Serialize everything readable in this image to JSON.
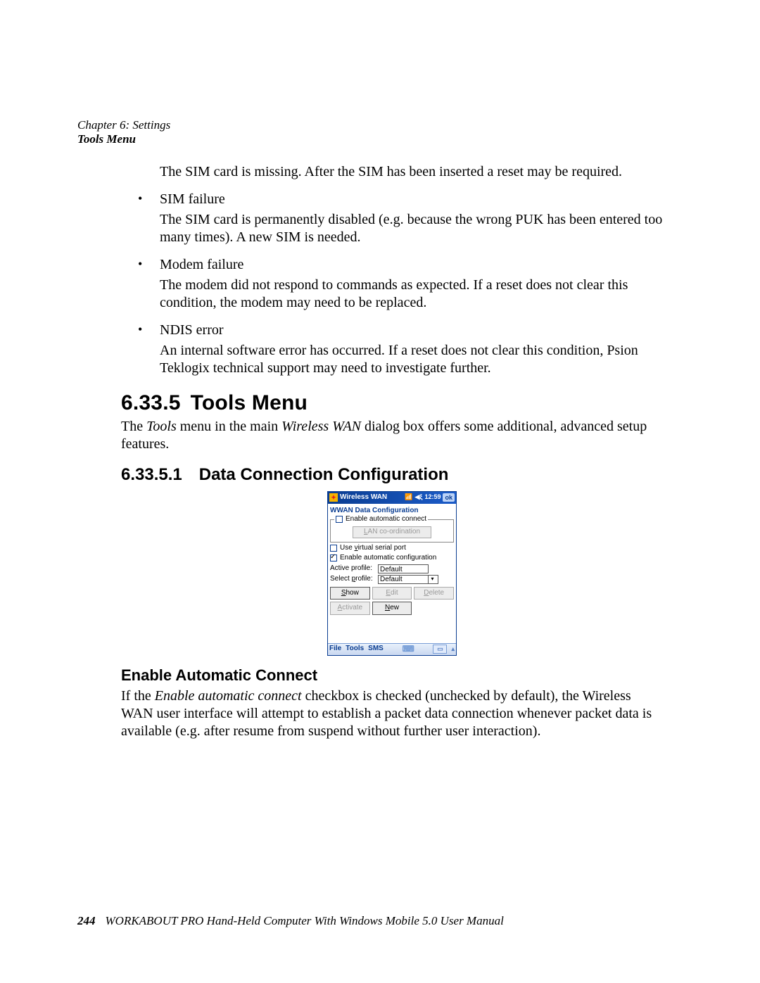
{
  "header": {
    "chapter": "Chapter 6:  Settings",
    "subtitle": "Tools Menu"
  },
  "lead": "The SIM card is missing. After the SIM has been inserted a reset may be required.",
  "bullets": [
    {
      "title": "SIM failure",
      "desc": "The SIM card is permanently disabled (e.g. because the wrong PUK has been entered too many times). A new SIM is needed."
    },
    {
      "title": "Modem failure",
      "desc": "The modem did not respond to commands as expected. If a reset does not clear this condition, the modem may need to be replaced."
    },
    {
      "title": "NDIS error",
      "desc": "An internal software error has occurred. If a reset does not clear this condition, Psion Teklogix technical support may need to investigate further."
    }
  ],
  "sections": {
    "tools_number": "6.33.5",
    "tools_title": "Tools Menu",
    "tools_intro_pre": "The ",
    "tools_intro_em1": "Tools",
    "tools_intro_mid": " menu in the main ",
    "tools_intro_em2": "Wireless WAN",
    "tools_intro_suf": " dialog box offers some additional, advanced setup features.",
    "dcc_number": "6.33.5.1",
    "dcc_title": "Data Connection Configuration",
    "eac_title": "Enable Automatic Connect",
    "eac_pre": "If the ",
    "eac_em": "Enable automatic connect",
    "eac_suf": " checkbox is checked (unchecked by default), the Wireless WAN user interface will attempt to establish a packet data connection whenever packet data is available (e.g. after resume from suspend without further user interaction)."
  },
  "screenshot": {
    "titlebar": {
      "title": "Wireless WAN",
      "signal_icon": "📶",
      "speaker_icon": "◀ξ",
      "time": "12:59",
      "ok": "ok"
    },
    "heading": "WWAN Data Configuration",
    "group1": {
      "enable_auto_connect": "Enable automatic connect",
      "lan_coord": "LAN co-ordination"
    },
    "cb_virtual": "Use virtual serial port",
    "cb_autoconf": "Enable automatic configuration",
    "active_label": "Active profile:",
    "active_value": "Default",
    "select_label": "Select profile:",
    "select_value": "Default",
    "buttons": {
      "show": "Show",
      "edit": "Edit",
      "delete": "Delete",
      "activate": "Activate",
      "new": "New"
    },
    "bottombar": {
      "file": "File",
      "tools": "Tools",
      "sms": "SMS"
    }
  },
  "footer": {
    "page_number": "244",
    "text": "WORKABOUT PRO Hand-Held Computer With Windows Mobile 5.0 User Manual"
  }
}
